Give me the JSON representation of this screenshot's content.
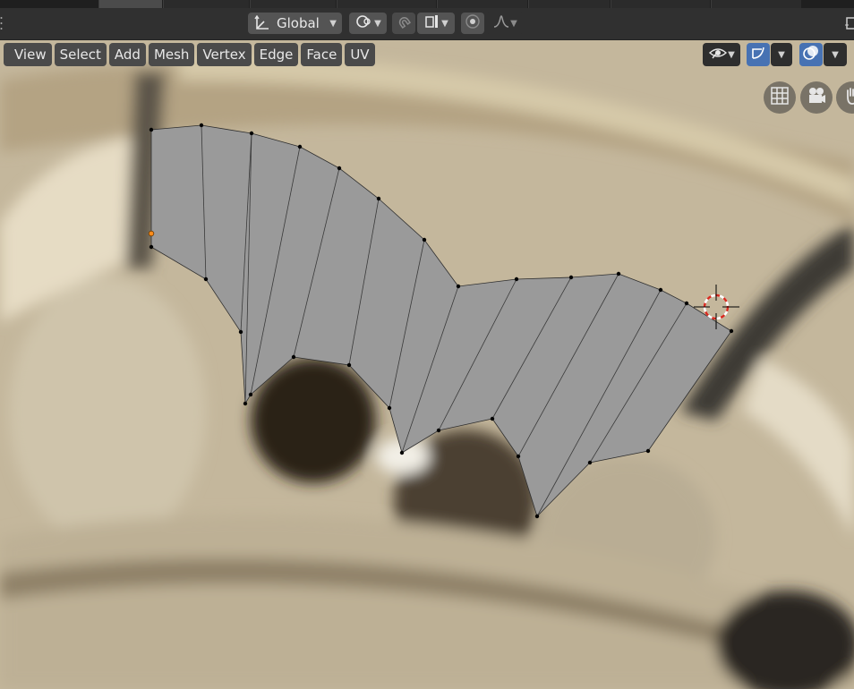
{
  "header": {
    "transform_orientation": "Global"
  },
  "menu": {
    "items": [
      "View",
      "Select",
      "Add",
      "Mesh",
      "Vertex",
      "Edge",
      "Face",
      "UV"
    ]
  },
  "icons": {
    "orientation": "transform-orientation-icon",
    "pivot": "pivot-point-icon",
    "snap": "snap-magnet-icon",
    "snap_target": "snap-increment-icon",
    "proportional": "proportional-editing-icon",
    "falloff": "falloff-curve-icon",
    "visibility": "visibility-eye-icon",
    "gizmo": "gizmo-icon",
    "overlay": "overlay-icon",
    "grid": "grid-view-icon",
    "camera": "camera-view-icon",
    "pan": "hand-pan-icon",
    "cursor": "3d-cursor-icon"
  },
  "colors": {
    "accent": "#4772b3",
    "face": "#9a9a9a",
    "vertex": "#000000",
    "active_vertex": "#ff8c1a",
    "cursor_red": "#d82b20"
  }
}
